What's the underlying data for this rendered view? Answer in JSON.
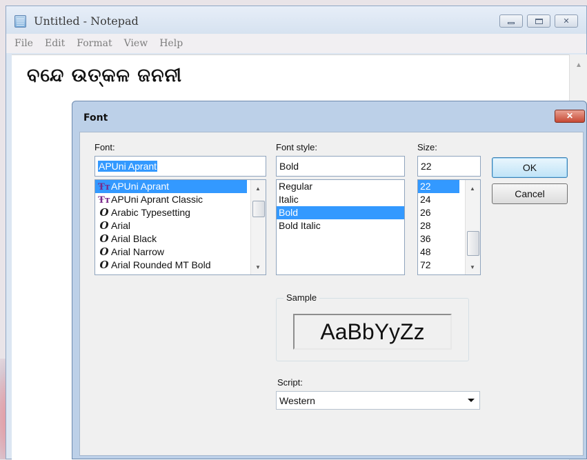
{
  "notepad": {
    "title": "Untitled - Notepad",
    "menu": [
      "File",
      "Edit",
      "Format",
      "View",
      "Help"
    ],
    "content": "ବନ୍ଦେ ଉତ୍କଳ ଜନନୀ"
  },
  "font_dialog": {
    "title": "Font",
    "close_label": "✕",
    "font": {
      "label": "Font:",
      "value": "APUni Aprant",
      "items": [
        {
          "name": "APUni Aprant",
          "icon": "truetype-icon",
          "selected": true
        },
        {
          "name": "APUni Aprant Classic",
          "icon": "truetype-icon",
          "selected": false
        },
        {
          "name": "Arabic Typesetting",
          "icon": "opentype-icon",
          "selected": false
        },
        {
          "name": "Arial",
          "icon": "opentype-icon",
          "selected": false
        },
        {
          "name": "Arial Black",
          "icon": "opentype-icon",
          "selected": false
        },
        {
          "name": "Arial Narrow",
          "icon": "opentype-icon",
          "selected": false
        },
        {
          "name": "Arial Rounded MT Bold",
          "icon": "opentype-icon",
          "selected": false
        }
      ]
    },
    "style": {
      "label": "Font style:",
      "value": "Bold",
      "items": [
        {
          "name": "Regular",
          "selected": false
        },
        {
          "name": "Italic",
          "selected": false
        },
        {
          "name": "Bold",
          "selected": true
        },
        {
          "name": "Bold Italic",
          "selected": false
        }
      ]
    },
    "size": {
      "label": "Size:",
      "value": "22",
      "items": [
        {
          "name": "22",
          "selected": true
        },
        {
          "name": "24",
          "selected": false
        },
        {
          "name": "26",
          "selected": false
        },
        {
          "name": "28",
          "selected": false
        },
        {
          "name": "36",
          "selected": false
        },
        {
          "name": "48",
          "selected": false
        },
        {
          "name": "72",
          "selected": false
        }
      ]
    },
    "ok_label": "OK",
    "cancel_label": "Cancel",
    "sample": {
      "legend": "Sample",
      "text": "AaBbYyZz"
    },
    "script": {
      "label": "Script:",
      "value": "Western"
    }
  }
}
